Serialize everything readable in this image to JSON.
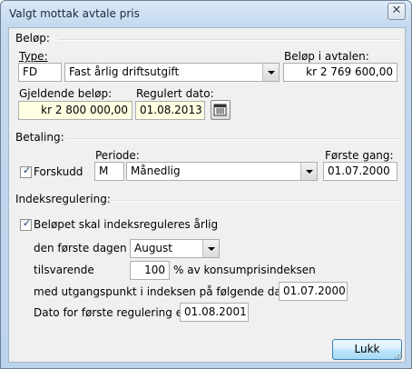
{
  "window": {
    "title": "Valgt mottak avtale pris",
    "close_symbol": "✕"
  },
  "belop": {
    "group_label": "Beløp:",
    "type_label": "Type:",
    "type_code": "FD",
    "type_selected": "Fast årlig driftsutgift",
    "belop_i_avtalen_label": "Beløp i avtalen:",
    "belop_i_avtalen_value": "kr 2 769 600,00",
    "gjeldende_belop_label": "Gjeldende beløp:",
    "gjeldende_belop_value": "kr 2 800 000,00",
    "regulert_dato_label": "Regulert dato:",
    "regulert_dato_value": "01.08.2013"
  },
  "betaling": {
    "group_label": "Betaling:",
    "forskudd_label": "Forskudd",
    "forskudd_checked": true,
    "periode_label": "Periode:",
    "periode_code": "M",
    "periode_selected": "Månedlig",
    "forste_gang_label": "Første gang:",
    "forste_gang_value": "01.07.2000"
  },
  "indeks": {
    "group_label": "Indeksregulering:",
    "arlig_label": "Beløpet skal indeksreguleres årlig",
    "arlig_checked": true,
    "forste_dagen_label": "den første dagen i",
    "month_selected": "August",
    "tilsvarende_label": "tilsvarende",
    "percent_value": "100",
    "percent_suffix": "% av konsumprisindeksen",
    "utgangspunkt_label": "med utgangspunkt i indeksen på følgende dato:",
    "utgangspunkt_value": "01.07.2000",
    "forste_regulering_label": "Dato for første regulering er:",
    "forste_regulering_value": "01.08.2001"
  },
  "footer": {
    "close_button_label": "Lukk"
  },
  "colors": {
    "yellow_field": "#ffffe1",
    "title_bar": "#c4d9ef",
    "dialog_bg": "#f0f0f0"
  },
  "icons": {
    "calendar_button": "calendar-icon",
    "checkbox_mark": "✓"
  }
}
